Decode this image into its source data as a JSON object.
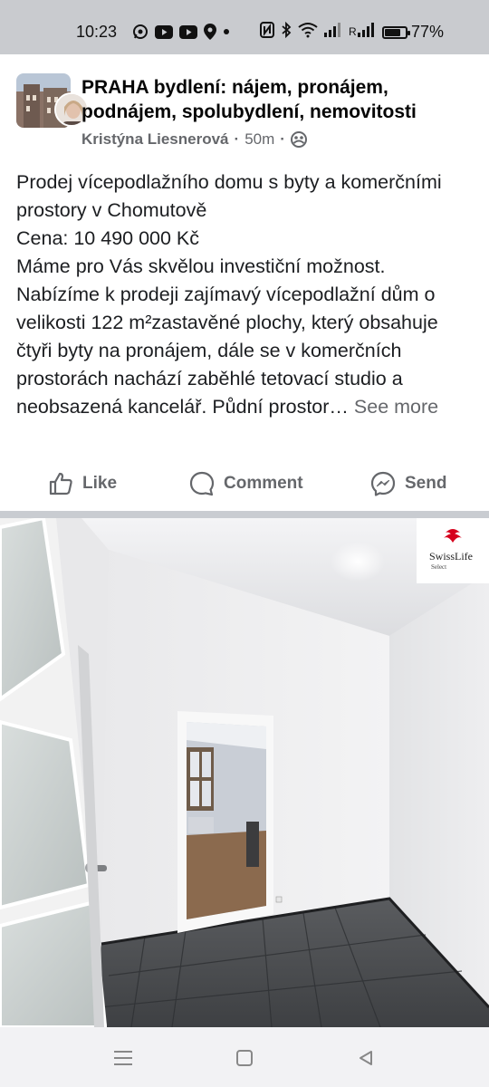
{
  "status_bar": {
    "time": "10:23",
    "battery_percent": "77%",
    "battery_level": 0.77,
    "icons": [
      "whatsapp-icon",
      "youtube-icon",
      "youtube-icon",
      "location-icon",
      "dot-icon",
      "nfc-icon",
      "bluetooth-icon",
      "wifi-icon",
      "signal-icon",
      "signal-r-icon",
      "battery-icon"
    ]
  },
  "post": {
    "group_name": "PRAHA bydlení: nájem, pronájem, podnájem, spolubydlení, nemovitosti",
    "author": "Kristýna Liesnerová",
    "separator": "·",
    "time": "50m",
    "separator2": "·",
    "privacy_icon": "group-icon",
    "text_lines": [
      "Prodej vícepodlažního domu s byty a komerčními prostory v Chomutově",
      "Cena: 10 490 000 Kč",
      "Máme pro Vás skvělou investiční možnost. Nabízíme k prodeji zajímavý vícepodlažní dům o velikosti 122 m²zastavěné plochy, který obsahuje čtyři byty na pronájem, dále se v komerčních prostorách nachází zaběhlé tetovací studio a neobsazená kancelář. Půdní prostor…"
    ],
    "see_more": "See more",
    "actions": {
      "like": "Like",
      "comment": "Comment",
      "send": "Send"
    },
    "photo_logo": {
      "line1": "SwissLife",
      "line2": "Select",
      "accent_color": "#d6001c"
    }
  },
  "nav_bar": {
    "icons": [
      "menu-icon",
      "home-square-icon",
      "back-triangle-icon"
    ]
  },
  "colors": {
    "status_bar_bg": "#c9cbcf",
    "secondary_text": "#65676b",
    "divider": "#c9ccd1"
  }
}
